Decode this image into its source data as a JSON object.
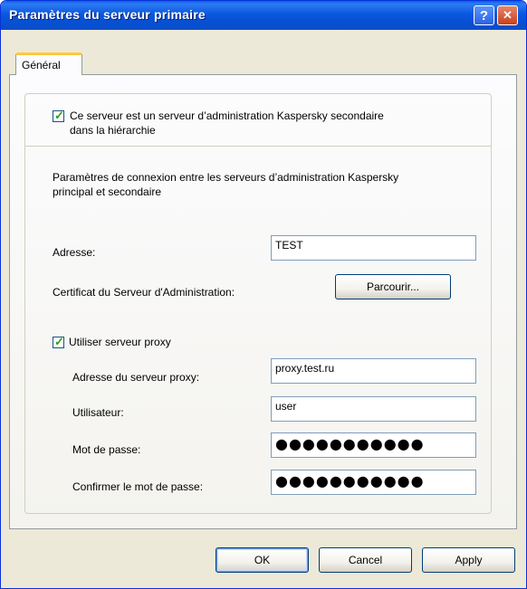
{
  "window": {
    "title": "Paramètres du serveur primaire",
    "help_glyph": "?",
    "close_glyph": "✕"
  },
  "tabs": [
    {
      "label": "Général",
      "active": true
    }
  ],
  "secondary_server": {
    "checked": true,
    "label_line1": "Ce serveur est un serveur d’administration Kaspersky secondaire",
    "label_line2": "dans la hiérarchie"
  },
  "connection": {
    "description_line1": "Paramètres de connexion entre les serveurs d’administration Kaspersky",
    "description_line2": "principal et secondaire",
    "address_label": "Adresse:",
    "address_value": "TEST",
    "certificate_label": "Certificat du Serveur d'Administration:",
    "browse_label": "Parcourir..."
  },
  "proxy": {
    "checked": true,
    "use_proxy_label": "Utiliser serveur proxy",
    "address_label": "Adresse du serveur proxy:",
    "address_value": "proxy.test.ru",
    "user_label": "Utilisateur:",
    "user_value": "user",
    "password_label": "Mot de passe:",
    "password_value": "●●●●●●●●●●●",
    "confirm_label": "Confirmer le mot de passe:",
    "confirm_value": "●●●●●●●●●●●"
  },
  "buttons": {
    "ok": "OK",
    "cancel": "Cancel",
    "apply": "Apply"
  },
  "colors": {
    "titlebar": "#0a58e0",
    "face": "#ece9d8",
    "tab_highlight": "#ffc83c",
    "check_mark": "#21a121"
  }
}
